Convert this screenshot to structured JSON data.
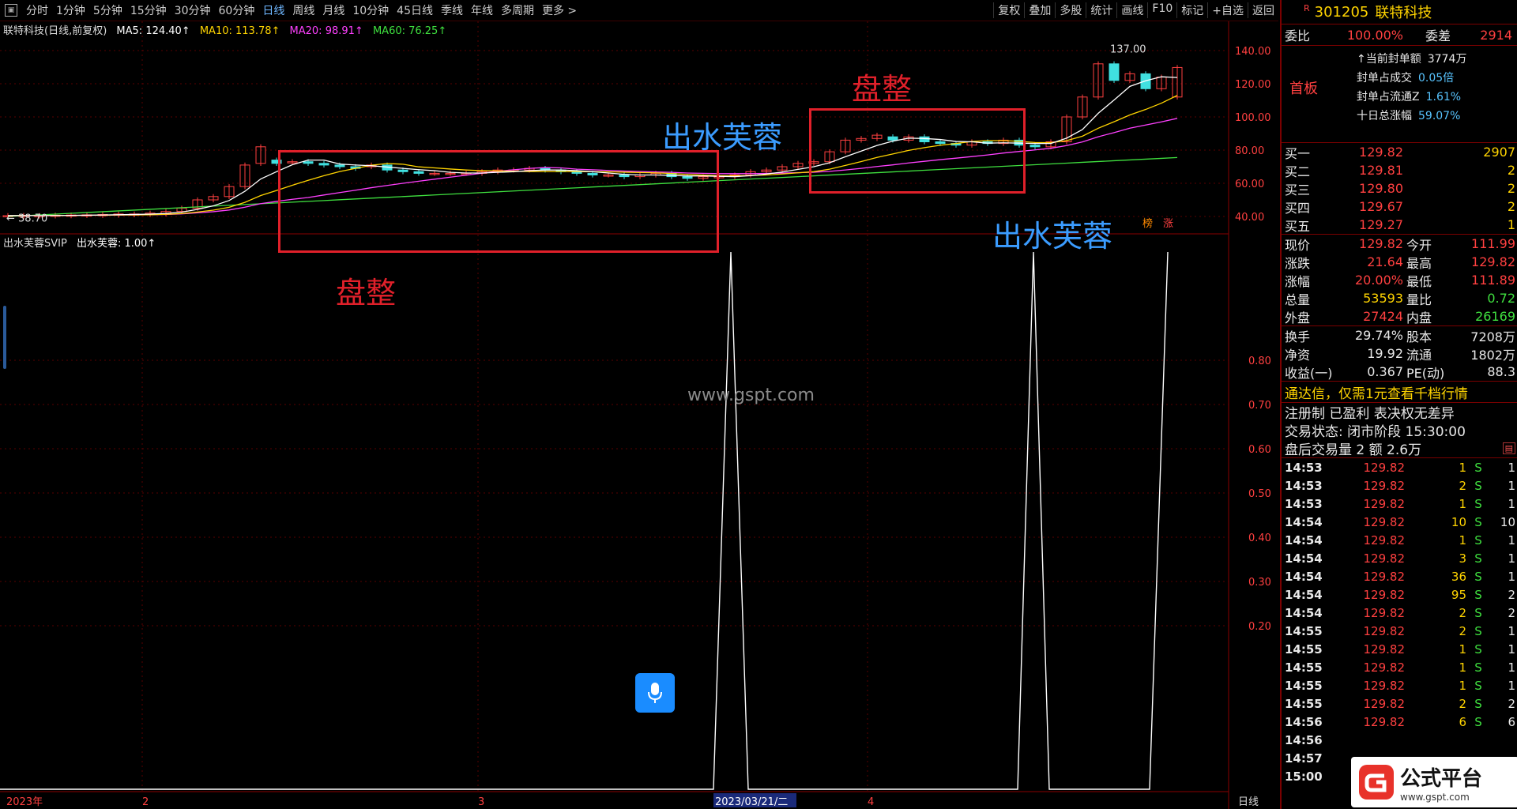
{
  "topbar": {
    "tabs": [
      "分时",
      "1分钟",
      "5分钟",
      "15分钟",
      "30分钟",
      "60分钟",
      "日线",
      "周线",
      "月线",
      "10分钟",
      "45日线",
      "季线",
      "年线",
      "多周期",
      "更多 >"
    ],
    "active_tab": "日线",
    "tools": [
      "复权",
      "叠加",
      "多股",
      "统计",
      "画线",
      "F10",
      "标记",
      "+自选",
      "返回"
    ]
  },
  "main_chart": {
    "legend_name": "联特科技(日线,前复权)",
    "ma5": "MA5: 124.40↑",
    "ma10": "MA10: 113.78↑",
    "ma20": "MA20: 98.91↑",
    "ma60": "MA60: 76.25↑",
    "price_ticks": [
      "140.00",
      "120.00",
      "100.00",
      "80.00",
      "60.00",
      "40.00"
    ],
    "low_label": "← 38.70",
    "high_label": "137.00",
    "tags": [
      "榜",
      "涨"
    ]
  },
  "indicator": {
    "legend_name": "出水芙蓉SVIP",
    "value": "出水芙蓉: 1.00↑",
    "ticks": [
      "0.80",
      "0.70",
      "0.60",
      "0.50",
      "0.40",
      "0.30",
      "0.20"
    ]
  },
  "bottom_axis": {
    "labels": [
      "2023年",
      "2",
      "3",
      "2023/03/21/二",
      "4"
    ],
    "right_label": "日线"
  },
  "annotations": {
    "panzheng": "盘整",
    "chushui": "出水芙蓉",
    "watermark": "www.gspt.com"
  },
  "stock": {
    "flag": "R",
    "code": "301205",
    "name": "联特科技",
    "weibi_label": "委比",
    "weibi_value": "100.00%",
    "weicha_label": "委差",
    "weicha_value": "2914",
    "board": "首板",
    "seal_info": [
      {
        "label": "当前封单额",
        "value": "3774万"
      },
      {
        "label": "封单占成交",
        "value": "0.05倍"
      },
      {
        "label": "封单占流通Z",
        "value": "1.61%"
      },
      {
        "label": "十日总涨幅",
        "value": "59.07%"
      }
    ],
    "bids": [
      {
        "label": "买一",
        "price": "129.82",
        "vol": "2907"
      },
      {
        "label": "买二",
        "price": "129.81",
        "vol": "2"
      },
      {
        "label": "买三",
        "price": "129.80",
        "vol": "2"
      },
      {
        "label": "买四",
        "price": "129.67",
        "vol": "2"
      },
      {
        "label": "买五",
        "price": "129.27",
        "vol": "1"
      }
    ],
    "quotes": [
      {
        "l1": "现价",
        "v1": "129.82",
        "l2": "今开",
        "v2": "111.99"
      },
      {
        "l1": "涨跌",
        "v1": "21.64",
        "l2": "最高",
        "v2": "129.82"
      },
      {
        "l1": "涨幅",
        "v1": "20.00%",
        "l2": "最低",
        "v2": "111.89"
      },
      {
        "l1": "总量",
        "v1": "53593",
        "l2": "量比",
        "v2": "0.72"
      },
      {
        "l1": "外盘",
        "v1": "27424",
        "l2": "内盘",
        "v2": "26169"
      }
    ],
    "fundamentals": [
      {
        "l1": "换手",
        "v1": "29.74%",
        "l2": "股本",
        "v2": "7208万"
      },
      {
        "l1": "净资",
        "v1": "19.92",
        "l2": "流通",
        "v2": "1802万"
      },
      {
        "l1": "收益(一)",
        "v1": "0.367",
        "l2": "PE(动)",
        "v2": "88.3"
      }
    ],
    "promo": "通达信，仅需1元查看千档行情",
    "notice": "注册制 已盈利 表决权无差异",
    "trade_state": "交易状态: 闭市阶段 15:30:00",
    "after_hours": "盘后交易量 2 额 2.6万",
    "ticks": [
      {
        "t": "14:53",
        "p": "129.82",
        "v": "1",
        "s": "S",
        "n": "1"
      },
      {
        "t": "14:53",
        "p": "129.82",
        "v": "2",
        "s": "S",
        "n": "1"
      },
      {
        "t": "14:53",
        "p": "129.82",
        "v": "1",
        "s": "S",
        "n": "1"
      },
      {
        "t": "14:54",
        "p": "129.82",
        "v": "10",
        "s": "S",
        "n": "10"
      },
      {
        "t": "14:54",
        "p": "129.82",
        "v": "1",
        "s": "S",
        "n": "1"
      },
      {
        "t": "14:54",
        "p": "129.82",
        "v": "3",
        "s": "S",
        "n": "1"
      },
      {
        "t": "14:54",
        "p": "129.82",
        "v": "36",
        "s": "S",
        "n": "1"
      },
      {
        "t": "14:54",
        "p": "129.82",
        "v": "95",
        "s": "S",
        "n": "2"
      },
      {
        "t": "14:54",
        "p": "129.82",
        "v": "2",
        "s": "S",
        "n": "2"
      },
      {
        "t": "14:55",
        "p": "129.82",
        "v": "2",
        "s": "S",
        "n": "1"
      },
      {
        "t": "14:55",
        "p": "129.82",
        "v": "1",
        "s": "S",
        "n": "1"
      },
      {
        "t": "14:55",
        "p": "129.82",
        "v": "1",
        "s": "S",
        "n": "1"
      },
      {
        "t": "14:55",
        "p": "129.82",
        "v": "1",
        "s": "S",
        "n": "1"
      },
      {
        "t": "14:55",
        "p": "129.82",
        "v": "2",
        "s": "S",
        "n": "2"
      },
      {
        "t": "14:56",
        "p": "129.82",
        "v": "6",
        "s": "S",
        "n": "6"
      },
      {
        "t": "14:56",
        "p": "",
        "v": "",
        "s": "",
        "n": ""
      },
      {
        "t": "14:57",
        "p": "",
        "v": "",
        "s": "",
        "n": ""
      },
      {
        "t": "15:00",
        "p": "",
        "v": "",
        "s": "",
        "n": ""
      }
    ]
  },
  "logo_text": "公式平台",
  "logo_url": "www.gspt.com",
  "colors": {
    "up": "#ff4040",
    "down": "#40e0e0",
    "ma5": "#ffffff",
    "ma10": "#ffd400",
    "ma20": "#ff40ff",
    "ma60": "#3fe03f",
    "frame": "#e0202a"
  }
}
